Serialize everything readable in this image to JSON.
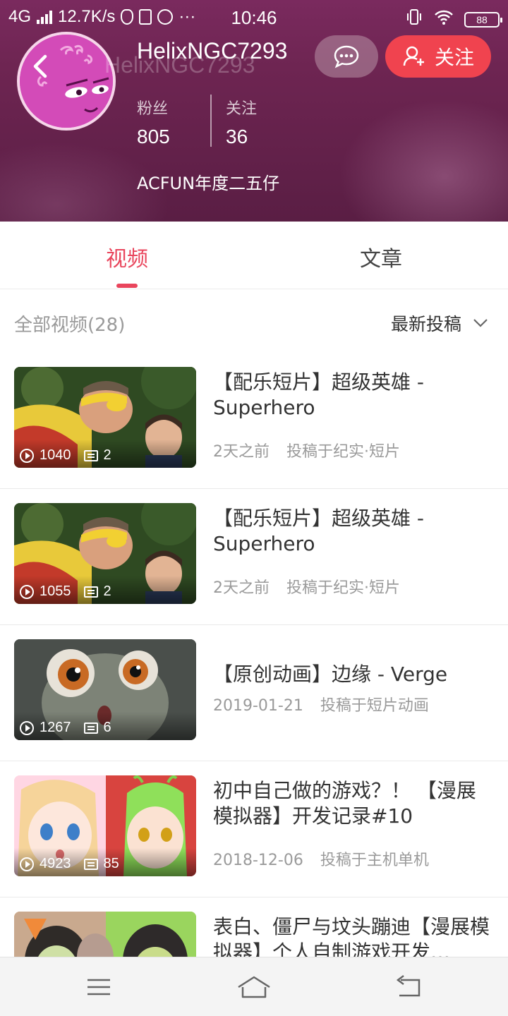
{
  "status_bar": {
    "network": "4G",
    "speed": "12.7K/s",
    "time": "10:46",
    "battery": "88"
  },
  "profile": {
    "username": "HelixNGC7293",
    "fans_label": "粉丝",
    "fans_count": "805",
    "following_label": "关注",
    "following_count": "36",
    "bio": "ACFUN年度二五仔",
    "follow_label": "关注"
  },
  "tabs": {
    "videos": "视频",
    "articles": "文章"
  },
  "filter": {
    "count_label": "全部视频(28)",
    "sort_label": "最新投稿"
  },
  "videos": [
    {
      "title": "【配乐短片】超级英雄 - Superhero",
      "time": "2天之前",
      "category": "投稿于纪实·短片",
      "plays": "1040",
      "comments": "2"
    },
    {
      "title": "【配乐短片】超级英雄 - Superhero",
      "time": "2天之前",
      "category": "投稿于纪实·短片",
      "plays": "1055",
      "comments": "2"
    },
    {
      "title": "【原创动画】边缘 - Verge",
      "time": "2019-01-21",
      "category": "投稿于短片动画",
      "plays": "1267",
      "comments": "6"
    },
    {
      "title": "初中自己做的游戏？！ 【漫展模拟器】开发记录#10",
      "time": "2018-12-06",
      "category": "投稿于主机单机",
      "plays": "4923",
      "comments": "85"
    },
    {
      "title": "表白、僵尸与坟头蹦迪【漫展模拟器】个人自制游戏开发…",
      "time": "",
      "category": "",
      "plays": "",
      "comments": ""
    }
  ],
  "colors": {
    "accent": "#e9455c",
    "follow_button": "#f0434f",
    "header_bg": "#6e2552"
  },
  "icons": {
    "back": "back-arrow-icon",
    "message": "chat-bubble-icon",
    "follow": "add-user-icon",
    "sort": "chevron-down-icon",
    "plays": "play-icon",
    "comments": "comment-icon",
    "nav_menu": "menu-icon",
    "nav_home": "home-icon",
    "nav_back": "return-icon"
  }
}
